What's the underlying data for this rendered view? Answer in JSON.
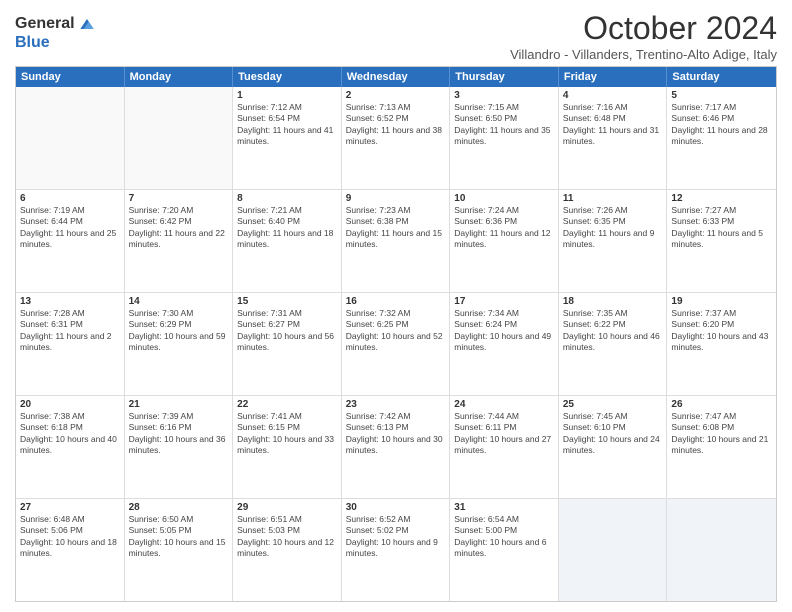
{
  "logo": {
    "general": "General",
    "blue": "Blue"
  },
  "title": "October 2024",
  "subtitle": "Villandro - Villanders, Trentino-Alto Adige, Italy",
  "days": [
    "Sunday",
    "Monday",
    "Tuesday",
    "Wednesday",
    "Thursday",
    "Friday",
    "Saturday"
  ],
  "weeks": [
    [
      {
        "day": "",
        "text": ""
      },
      {
        "day": "",
        "text": ""
      },
      {
        "day": "1",
        "text": "Sunrise: 7:12 AM\nSunset: 6:54 PM\nDaylight: 11 hours and 41 minutes."
      },
      {
        "day": "2",
        "text": "Sunrise: 7:13 AM\nSunset: 6:52 PM\nDaylight: 11 hours and 38 minutes."
      },
      {
        "day": "3",
        "text": "Sunrise: 7:15 AM\nSunset: 6:50 PM\nDaylight: 11 hours and 35 minutes."
      },
      {
        "day": "4",
        "text": "Sunrise: 7:16 AM\nSunset: 6:48 PM\nDaylight: 11 hours and 31 minutes."
      },
      {
        "day": "5",
        "text": "Sunrise: 7:17 AM\nSunset: 6:46 PM\nDaylight: 11 hours and 28 minutes."
      }
    ],
    [
      {
        "day": "6",
        "text": "Sunrise: 7:19 AM\nSunset: 6:44 PM\nDaylight: 11 hours and 25 minutes."
      },
      {
        "day": "7",
        "text": "Sunrise: 7:20 AM\nSunset: 6:42 PM\nDaylight: 11 hours and 22 minutes."
      },
      {
        "day": "8",
        "text": "Sunrise: 7:21 AM\nSunset: 6:40 PM\nDaylight: 11 hours and 18 minutes."
      },
      {
        "day": "9",
        "text": "Sunrise: 7:23 AM\nSunset: 6:38 PM\nDaylight: 11 hours and 15 minutes."
      },
      {
        "day": "10",
        "text": "Sunrise: 7:24 AM\nSunset: 6:36 PM\nDaylight: 11 hours and 12 minutes."
      },
      {
        "day": "11",
        "text": "Sunrise: 7:26 AM\nSunset: 6:35 PM\nDaylight: 11 hours and 9 minutes."
      },
      {
        "day": "12",
        "text": "Sunrise: 7:27 AM\nSunset: 6:33 PM\nDaylight: 11 hours and 5 minutes."
      }
    ],
    [
      {
        "day": "13",
        "text": "Sunrise: 7:28 AM\nSunset: 6:31 PM\nDaylight: 11 hours and 2 minutes."
      },
      {
        "day": "14",
        "text": "Sunrise: 7:30 AM\nSunset: 6:29 PM\nDaylight: 10 hours and 59 minutes."
      },
      {
        "day": "15",
        "text": "Sunrise: 7:31 AM\nSunset: 6:27 PM\nDaylight: 10 hours and 56 minutes."
      },
      {
        "day": "16",
        "text": "Sunrise: 7:32 AM\nSunset: 6:25 PM\nDaylight: 10 hours and 52 minutes."
      },
      {
        "day": "17",
        "text": "Sunrise: 7:34 AM\nSunset: 6:24 PM\nDaylight: 10 hours and 49 minutes."
      },
      {
        "day": "18",
        "text": "Sunrise: 7:35 AM\nSunset: 6:22 PM\nDaylight: 10 hours and 46 minutes."
      },
      {
        "day": "19",
        "text": "Sunrise: 7:37 AM\nSunset: 6:20 PM\nDaylight: 10 hours and 43 minutes."
      }
    ],
    [
      {
        "day": "20",
        "text": "Sunrise: 7:38 AM\nSunset: 6:18 PM\nDaylight: 10 hours and 40 minutes."
      },
      {
        "day": "21",
        "text": "Sunrise: 7:39 AM\nSunset: 6:16 PM\nDaylight: 10 hours and 36 minutes."
      },
      {
        "day": "22",
        "text": "Sunrise: 7:41 AM\nSunset: 6:15 PM\nDaylight: 10 hours and 33 minutes."
      },
      {
        "day": "23",
        "text": "Sunrise: 7:42 AM\nSunset: 6:13 PM\nDaylight: 10 hours and 30 minutes."
      },
      {
        "day": "24",
        "text": "Sunrise: 7:44 AM\nSunset: 6:11 PM\nDaylight: 10 hours and 27 minutes."
      },
      {
        "day": "25",
        "text": "Sunrise: 7:45 AM\nSunset: 6:10 PM\nDaylight: 10 hours and 24 minutes."
      },
      {
        "day": "26",
        "text": "Sunrise: 7:47 AM\nSunset: 6:08 PM\nDaylight: 10 hours and 21 minutes."
      }
    ],
    [
      {
        "day": "27",
        "text": "Sunrise: 6:48 AM\nSunset: 5:06 PM\nDaylight: 10 hours and 18 minutes."
      },
      {
        "day": "28",
        "text": "Sunrise: 6:50 AM\nSunset: 5:05 PM\nDaylight: 10 hours and 15 minutes."
      },
      {
        "day": "29",
        "text": "Sunrise: 6:51 AM\nSunset: 5:03 PM\nDaylight: 10 hours and 12 minutes."
      },
      {
        "day": "30",
        "text": "Sunrise: 6:52 AM\nSunset: 5:02 PM\nDaylight: 10 hours and 9 minutes."
      },
      {
        "day": "31",
        "text": "Sunrise: 6:54 AM\nSunset: 5:00 PM\nDaylight: 10 hours and 6 minutes."
      },
      {
        "day": "",
        "text": ""
      },
      {
        "day": "",
        "text": ""
      }
    ]
  ]
}
